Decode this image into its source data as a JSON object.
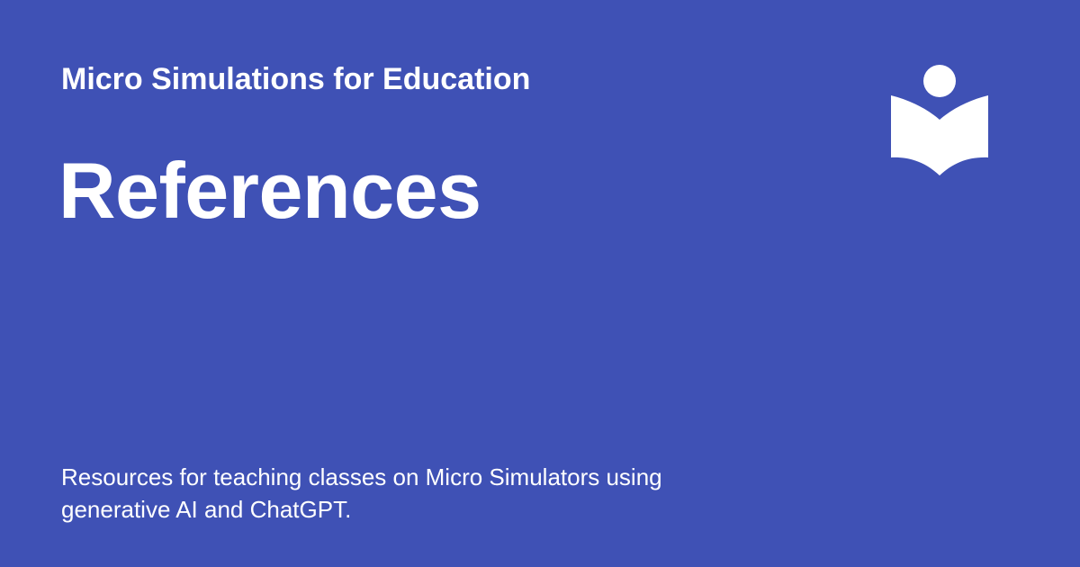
{
  "site": {
    "name": "Micro Simulations for Education",
    "logo_icon": "open-book-reader-icon"
  },
  "page": {
    "title": "References",
    "description": "Resources for teaching classes on Micro Simulators using generative AI and ChatGPT."
  },
  "colors": {
    "background": "#3f51b5",
    "text": "#ffffff",
    "logo": "#ffffff"
  }
}
